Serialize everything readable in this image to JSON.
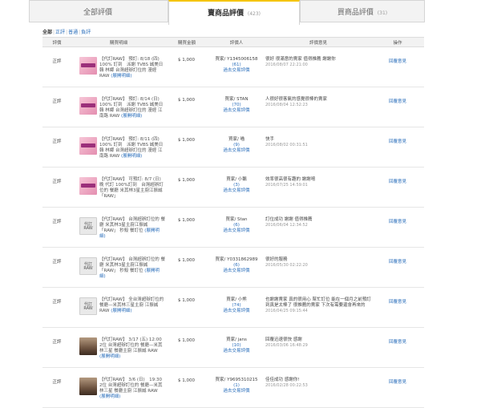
{
  "tabs": [
    {
      "label": "全部評價",
      "count": ""
    },
    {
      "label": "賣商品評價",
      "count": "(423)"
    },
    {
      "label": "買商品評價",
      "count": "(31)"
    }
  ],
  "filter": {
    "all": "全部",
    "positive": "正評",
    "neutral": "普通",
    "negative": "負評"
  },
  "table": {
    "headers": [
      "評價",
      "購買明細",
      "購買金額",
      "評價人",
      "評價意見",
      "操作"
    ],
    "rows": [
      {
        "type": "正評",
        "thumb": "pink",
        "thumb_text": "",
        "item": "【代訂RAW】 預訂: 8/18 (四) 100% 訂到　派謝 TVBS 誠美日韓 林鄉 台灣超辦訂位的 漫經 RAW",
        "item_link": "(展開明細)",
        "amount": "$ 1,000",
        "buyer": "買家/ Y1345006158",
        "buyer_count": "(61)",
        "history": "過去交易評價",
        "comment": "很好 很滿意的賣家 值得推薦 謝謝你",
        "date": "2016/08/07 22:21:00",
        "op": "回覆意見"
      },
      {
        "type": "正評",
        "thumb": "pink",
        "thumb_text": "",
        "item": "【代訂RAW】 預訂: 8/14 (日) 100% 訂到　派謝 TVBS 誠美日韓 林鄉 台灣超辦訂位的 漫經 江南路 RAW",
        "item_link": "(展開明細)",
        "amount": "$ 1,000",
        "buyer": "買家/ STAN",
        "buyer_count": "(70)",
        "history": "過去交易評價",
        "comment": "人很好很客氣的感覺很棒的賣家",
        "date": "2016/08/04 12:52:23",
        "op": "回覆意見"
      },
      {
        "type": "正評",
        "thumb": "pink",
        "thumb_text": "",
        "item": "【代訂RAW】 預訂: 8/11 (四) 100% 訂到　派謝 TVBS 誠美日韓 林鄉 台灣超辦訂位的 漫經 江南路 RAW",
        "item_link": "(展開明細)",
        "amount": "$ 1,000",
        "buyer": "買家/ 喵",
        "buyer_count": "(9)",
        "history": "過去交易評價",
        "comment": "快手",
        "date": "2016/08/02 00:31:51",
        "op": "回覆意見"
      },
      {
        "type": "正評",
        "thumb": "pink",
        "thumb_text": "",
        "item": "【代訂RAW】 可預訂: 8/7 (日) 晚 代訂 100%訂到　台灣超辦訂位的 餐廳 米其林3星主廚江振誠 「RAW」",
        "item_link": "",
        "amount": "$ 1,000",
        "buyer": "買家/ 小鵝",
        "buyer_count": "(3)",
        "history": "過去交易評價",
        "comment": "效率很高很有趣的 謝謝唷",
        "date": "2016/07/25 14:59:01",
        "op": "回覆意見"
      },
      {
        "type": "正評",
        "thumb": "grey",
        "thumb_text": "代訂 RAW",
        "item": "【代訂RAW】 台灣超辦訂位的 餐廳 米其林3星主廚江振誠 「RAW」 秒殺 餐訂位",
        "item_link": "(展開明細)",
        "amount": "$ 1,000",
        "buyer": "買家/ Stan",
        "buyer_count": "(6)",
        "history": "過去交易評價",
        "comment": "訂位成功 謝謝 值得推薦",
        "date": "2016/06/04 12:34:52",
        "op": "回覆意見"
      },
      {
        "type": "正評",
        "thumb": "grey",
        "thumb_text": "代訂 RAW",
        "item": "【代訂RAW】 台灣超辦訂位的 餐廳 米其林3星主廚江振誠 「RAW」 秒殺 餐訂位",
        "item_link": "(展開明細)",
        "amount": "$ 1,000",
        "buyer": "買家/ Y0331862989",
        "buyer_count": "(6)",
        "history": "過去交易評價",
        "comment": "很好的服務",
        "date": "2016/05/30 02:22:20",
        "op": "回覆意見"
      },
      {
        "type": "正評",
        "thumb": "grey",
        "thumb_text": "代訂 RAW",
        "item": "【代訂RAW】 全台灣超辦訂位的 餐廳—米其林三星主廚 江振誠 RAW",
        "item_link": "(展開明細)",
        "amount": "$ 1,000",
        "buyer": "買家/ 小熊",
        "buyer_count": "(74)",
        "history": "過去交易評價",
        "comment": "也謝謝賣家 真的很用心 幫忙訂位 能在一個月之前預訂到真是太棒了 很推薦的賣家 下次有需要還會再來的",
        "date": "2016/04/25 09:15:44",
        "op": "回覆意見"
      },
      {
        "type": "正評",
        "thumb": "photo",
        "thumb_text": "",
        "item": "【代訂RAW】 3/17 (五) 12:00　2位 台灣超辦訂位的 餐廳—米其林三星 餐廳主廚 江振誠 RAW",
        "item_link": "(展開明細)",
        "amount": "$ 1,000",
        "buyer": "買家/ jans",
        "buyer_count": "(10)",
        "history": "過去交易評價",
        "comment": "回覆迅速很快 感謝",
        "date": "2016/03/06 16:48:29",
        "op": "回覆意見"
      },
      {
        "type": "正評",
        "thumb": "photo",
        "thumb_text": "",
        "item": "【代訂RAW】 3/6 (日)　19:30　2位 台灣超辦訂位的 餐廳—米其林三星 餐廳主廚 江振誠 RAW",
        "item_link": "(展開明細)",
        "amount": "$ 1,000",
        "buyer": "買家/ Y9695310215",
        "buyer_count": "(1)",
        "history": "過去交易評價",
        "comment": "佳佳成功 感謝你!",
        "date": "2016/02/28 00:22:53",
        "op": "回覆意見"
      }
    ]
  },
  "colors": {
    "accent": "#f5c400",
    "link": "#2a6ebb"
  }
}
